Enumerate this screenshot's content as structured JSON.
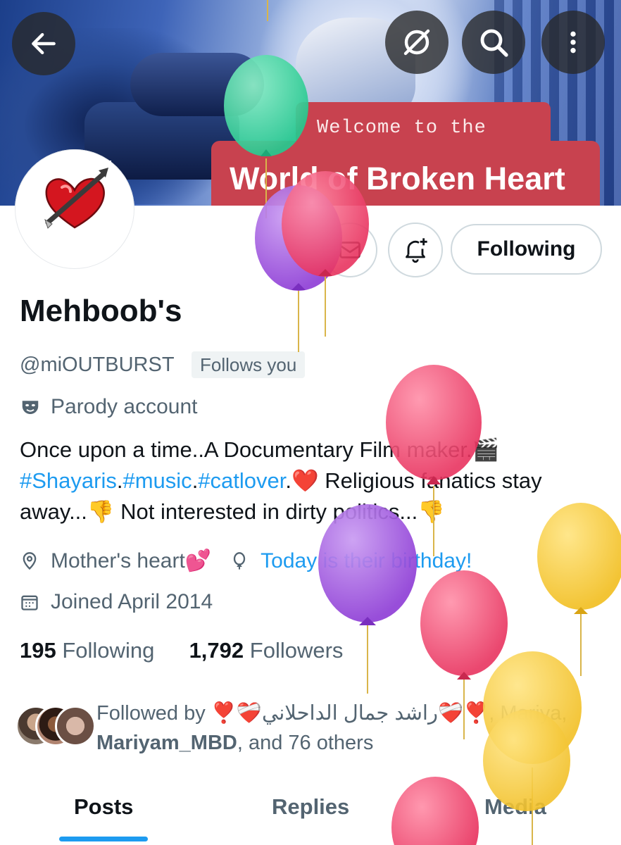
{
  "banner": {
    "line1": "Welcome to the",
    "line2": "World of Broken Heart"
  },
  "top_actions": {
    "back_icon": "arrow-left-icon",
    "grok_icon": "circle-slash-icon",
    "search_icon": "search-icon",
    "more_icon": "more-vertical-icon"
  },
  "profile": {
    "name": "Mehboob's",
    "handle": "@miOUTBURST",
    "follows_you": "Follows you",
    "parody_label": "Parody account",
    "following_button": "Following"
  },
  "bio": {
    "line1_text": "Once upon a time..A Documentary Film maker.",
    "emoji_clapper": "🎬",
    "hashtag1": "#Shayaris",
    "hashtag2": "#music",
    "hashtag3": "#catlover",
    "dot": ".",
    "emoji_heart": "❤️",
    "line2_rest": " Religious fanatics stay away...",
    "emoji_thumbs1": "👎",
    "line3_text": " Not interested in dirty politics...",
    "emoji_thumbs2": "👎"
  },
  "meta": {
    "location": "Mother's heart💕",
    "birthday": "Today is their birthday!",
    "joined": "Joined April 2014"
  },
  "counts": {
    "following_num": "195",
    "following_label": "Following",
    "followers_num": "1,792",
    "followers_label": "Followers"
  },
  "followed_by": {
    "prefix": "Followed by ",
    "user1": "❣️❤️‍🩹راشد جمال الداحلاني❤️‍🩹❣️",
    "sep1": ", Mariya,",
    "user2": "Mariyam_MBD",
    "suffix": ", and 76 others"
  },
  "tabs": [
    "Posts",
    "Replies",
    "Media"
  ],
  "colors": {
    "accent": "#1d9bf0",
    "banner_red": "#c8424f",
    "text_secondary": "#536471"
  }
}
